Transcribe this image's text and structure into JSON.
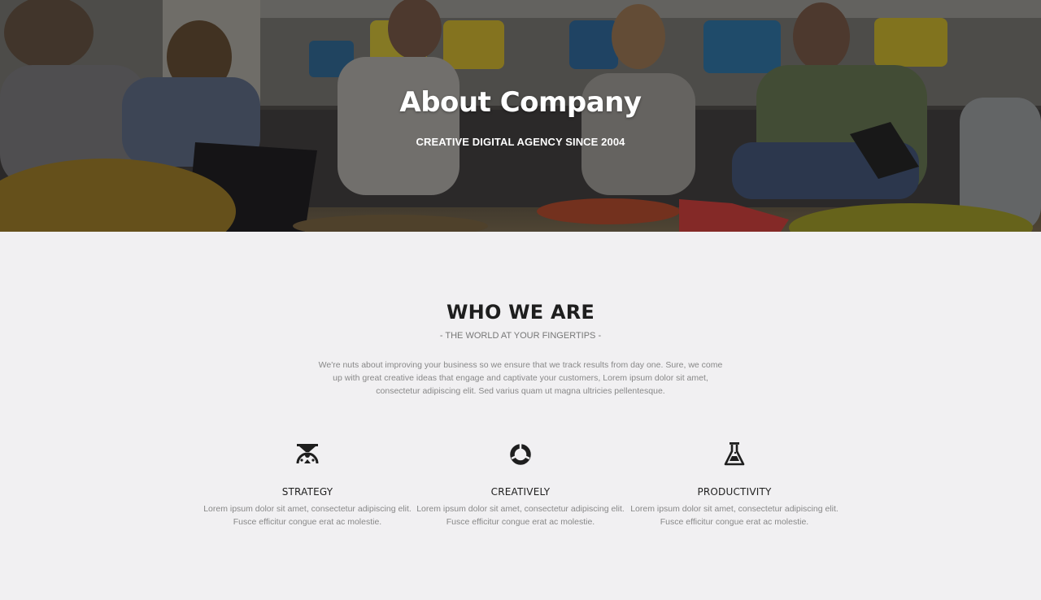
{
  "hero": {
    "title": "About Company",
    "subtitle": "CREATIVE DIGITAL AGENCY SINCE 2004"
  },
  "about": {
    "title": "WHO WE ARE",
    "subtitle": "- THE WORLD AT YOUR FINGERTIPS -",
    "description": "We're nuts about improving your business so we ensure that we track results from day one. Sure, we come up with great creative ideas that engage and captivate your customers, Lorem ipsum dolor sit amet, consectetur adipiscing elit. Sed varius quam ut magna ultricies pellentesque."
  },
  "features": [
    {
      "icon": "strategy-icon",
      "title": "STRATEGY",
      "text": "Lorem ipsum dolor sit amet, consectetur adipiscing elit. Fusce efficitur congue erat ac molestie."
    },
    {
      "icon": "circle-segments-icon",
      "title": "CREATIVELY",
      "text": "Lorem ipsum dolor sit amet, consectetur adipiscing elit. Fusce efficitur congue erat ac molestie."
    },
    {
      "icon": "flask-icon",
      "title": "PRODUCTIVITY",
      "text": "Lorem ipsum dolor sit amet, consectetur adipiscing elit. Fusce efficitur congue erat ac molestie."
    }
  ],
  "colors": {
    "background": "#f1f0f2",
    "heading": "#1e1e1e",
    "body_text": "#888888"
  }
}
